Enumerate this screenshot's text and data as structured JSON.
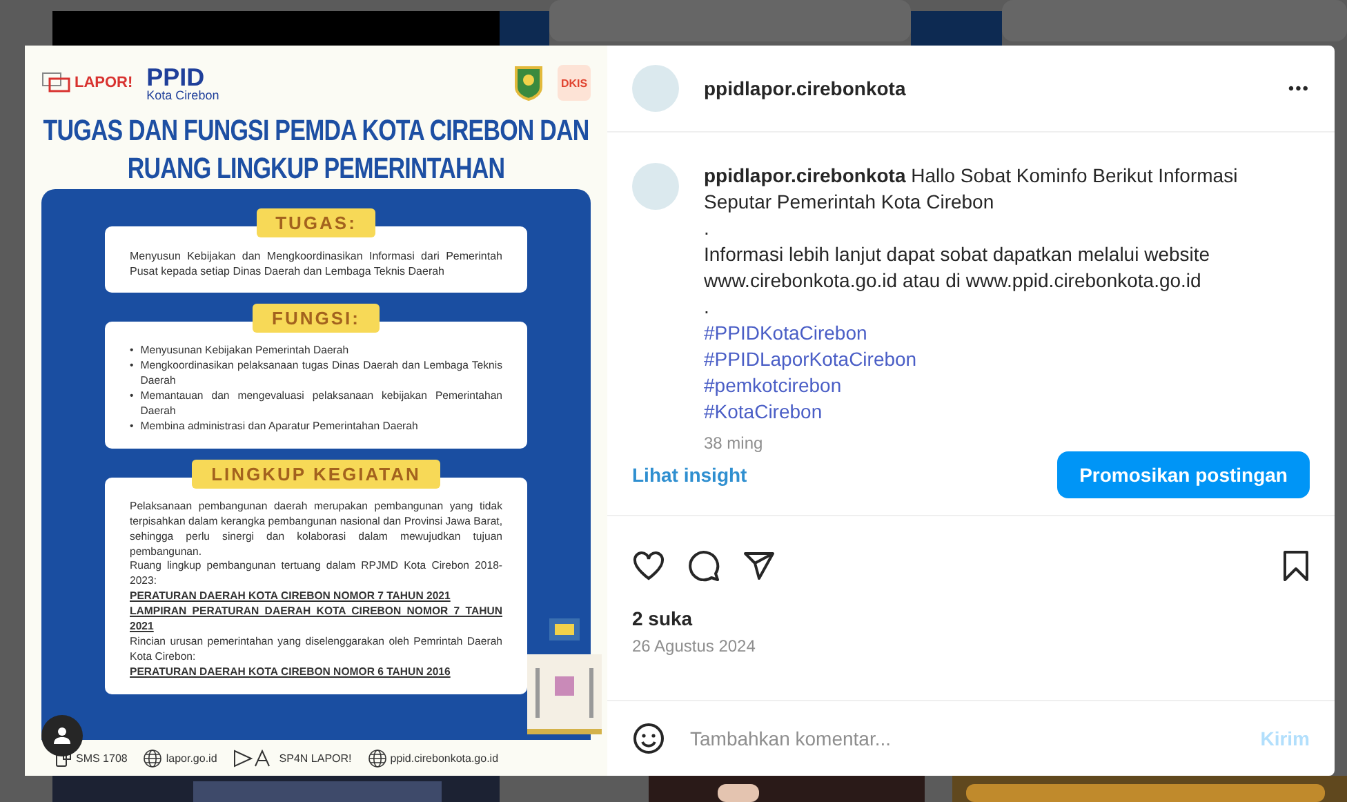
{
  "infographic": {
    "logos": [
      {
        "kind": "lapor",
        "text": "LAPOR!"
      },
      {
        "kind": "ppid",
        "text": "PPID",
        "sub": "Kota Cirebon"
      }
    ],
    "badge": "DKIS",
    "title_lines": [
      "TUGAS DAN FUNGSI PEMDA KOTA CIREBON DAN",
      "RUANG LINGKUP PEMERINTAHAN"
    ],
    "sections": [
      {
        "heading": "TUGAS:",
        "kind": "paragraph",
        "text": "Menyusun Kebijakan dan Mengkoordinasikan Informasi dari Pemerintah Pusat kepada setiap Dinas Daerah dan Lembaga Teknis Daerah"
      },
      {
        "heading": "FUNGSI:",
        "kind": "bullets",
        "marker": "•",
        "items": [
          "Menyusunan Kebijakan Pemerintah Daerah",
          "Mengkoordinasikan pelaksanaan tugas Dinas Daerah dan Lembaga Teknis Daerah",
          "Memantauan dan mengevaluasi pelaksanaan kebijakan Pemerintahan Daerah",
          "Membina administrasi dan Aparatur Pemerintahan Daerah"
        ]
      },
      {
        "heading": "LINGKUP KEGIATAN",
        "kind": "lines",
        "lines": [
          {
            "text": "Pelaksanaan pembangunan daerah merupakan pembangunan yang tidak terpisahkan dalam kerangka pembangunan nasional dan Provinsi Jawa Barat, sehingga perlu sinergi dan kolaborasi dalam mewujudkan tujuan pembangunan.",
            "emphasis": false
          },
          {
            "text": "Ruang lingkup pembangunan tertuang dalam RPJMD Kota Cirebon 2018-2023:",
            "emphasis": false
          },
          {
            "text": "PERATURAN DAERAH KOTA CIREBON NOMOR 7 TAHUN 2021",
            "emphasis": true
          },
          {
            "text": "LAMPIRAN PERATURAN DAERAH KOTA CIREBON NOMOR 7 TAHUN 2021",
            "emphasis": true
          },
          {
            "text": "Rincian urusan pemerintahan yang diselenggarakan oleh Pemrintah Daerah Kota Cirebon:",
            "emphasis": false
          },
          {
            "text": "PERATURAN DAERAH KOTA CIREBON NOMOR 6 TAHUN 2016",
            "emphasis": true
          }
        ]
      }
    ],
    "footer": [
      {
        "kind": "phone",
        "text": "SMS 1708"
      },
      {
        "kind": "globe",
        "text": "lapor.go.id"
      },
      {
        "kind": "play",
        "text": "SP4N LAPOR!"
      },
      {
        "kind": "globe",
        "text": "ppid.cirebonkota.go.id"
      }
    ]
  },
  "header": {
    "username": "ppidlapor.cirebonkota",
    "more": "•••"
  },
  "caption": {
    "intro": "**ppidlapor.cirebonkota** Hallo Sobat Kominfo Berikut Informasi Seputar Pemerintah Kota Cirebon",
    "lines": [
      ".",
      "Informasi lebih lanjut dapat sobat dapatkan melalui website www.cirebonkota.go.id atau di www.ppid.cirebonkota.go.id",
      "."
    ],
    "hashtags": [
      "#PPIDKotaCirebon",
      "#PPIDLaporKotaCirebon",
      "#pemkotcirebon",
      "#KotaCirebon"
    ],
    "time": "38 ming"
  },
  "insight_link": "Lihat insight",
  "promote_button": "Promosikan postingan",
  "likes": "2 suka",
  "date": "26 Agustus 2024",
  "comment": {
    "placeholder": "Tambahkan komentar...",
    "post_button": "Kirim",
    "post_disabled": true
  }
}
